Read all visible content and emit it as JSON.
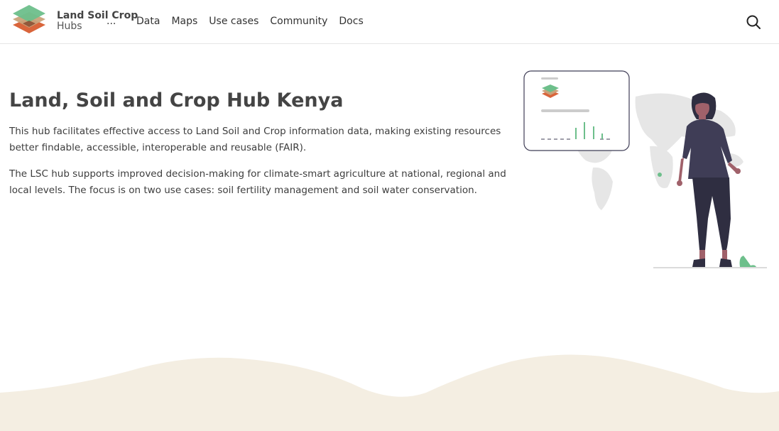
{
  "header": {
    "brand_title": "Land Soil Crop",
    "brand_sub": "Hubs",
    "more": "...",
    "nav": [
      "Data",
      "Maps",
      "Use cases",
      "Community",
      "Docs"
    ],
    "search_icon": "search-icon"
  },
  "hero": {
    "title": "Land, Soil and Crop Hub Kenya",
    "paragraphs": [
      "This hub facilitates effective access to Land Soil and Crop information data, making existing resources better findable, accessible, interoperable and reusable (FAIR).",
      "The LSC hub supports improved decision-making for climate-smart agriculture at national, regional and local levels. The focus is on two use cases: soil fertility management and soil water conservation."
    ]
  },
  "colors": {
    "green": "#6dbf8b",
    "tan": "#c9a27a",
    "orange": "#d9653b",
    "wave": "#f4eee2",
    "figure_dark": "#3f3d56"
  }
}
